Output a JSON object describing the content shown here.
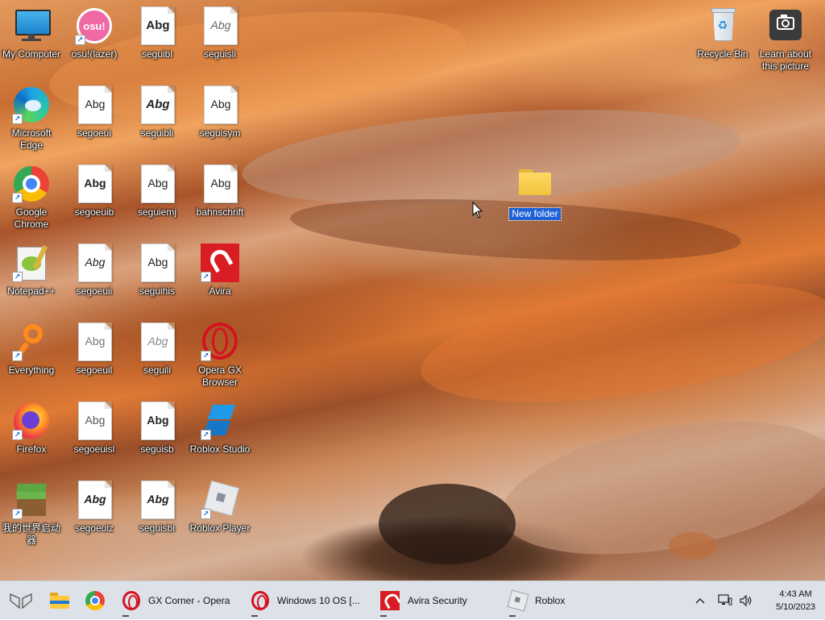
{
  "desktop": {
    "icons": {
      "my_computer": "My Computer",
      "osu": "osu!(lazer)",
      "seguibl_1": "seguibl",
      "seguisli": "seguisli",
      "edge": "Microsoft Edge",
      "segoeui": "segoeui",
      "seguibli": "seguibli",
      "seguisym": "seguisym",
      "chrome": "Google Chrome",
      "segoeuib": "segoeuib",
      "seguiemj": "seguiemj",
      "bahnschrift": "bahnschrift",
      "notepad": "Notepad++",
      "segoeuii": "segoeuii",
      "seguihis": "seguihis",
      "avira": "Avira",
      "everything": "Everything",
      "segoeuil": "segoeuil",
      "seguili": "seguili",
      "opera_gx": "Opera GX Browser",
      "firefox": "Firefox",
      "segoeuisl": "segoeuisl",
      "seguisb": "seguisb",
      "roblox_studio": "Roblox Studio",
      "minecraft": "我的世界启动器",
      "segoeuiz": "segoeuiz",
      "seguisbi": "seguisbi",
      "roblox_player": "Roblox Player",
      "recycle_bin": "Recycle Bin",
      "learn_picture": "Learn about this picture",
      "new_folder": "New folder"
    },
    "font_preview": "Abg"
  },
  "taskbar": {
    "apps": [
      {
        "label": "GX Corner - Opera"
      },
      {
        "label": "Windows 10 OS [..."
      },
      {
        "label": "Avira Security"
      },
      {
        "label": "Roblox"
      }
    ],
    "osu_logo": "osu!",
    "time": "4:43 AM",
    "date": "5/10/2023"
  },
  "colors": {
    "taskbar_bg": "#dde1e8",
    "selection": "#1e63d6",
    "opera_red": "#d6121f",
    "avira_red": "#d81e24"
  }
}
